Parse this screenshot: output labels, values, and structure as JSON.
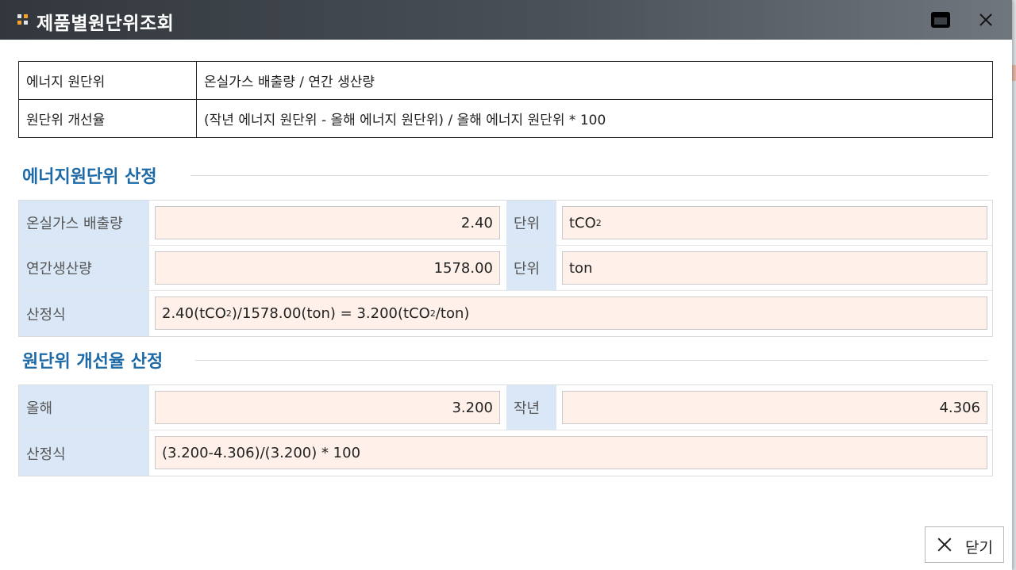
{
  "window": {
    "title": "제품별원단위조회"
  },
  "info_table": [
    {
      "key": "에너지 원단위",
      "value": "온실가스 배출량 / 연간 생산량"
    },
    {
      "key": "원단위 개선율",
      "value": "(작년 에너지 원단위 - 올해 에너지 원단위) / 올해 에너지 원단위 * 100"
    }
  ],
  "section1": {
    "title": "에너지원단위 산정",
    "emission_label": "온실가스 배출량",
    "emission_value": "2.40",
    "emission_unit_label": "단위",
    "emission_unit_base": "tCO",
    "emission_unit_sub": "2",
    "production_label": "연간생산량",
    "production_value": "1578.00",
    "production_unit_label": "단위",
    "production_unit": "ton",
    "formula_label": "산정식",
    "formula": {
      "p1": "2.40(tCO",
      "s1": "2",
      "p2": ")/1578.00(ton) = 3.200(tCO",
      "s2": "2",
      "p3": "/ton)"
    }
  },
  "section2": {
    "title": "원단위 개선율 산정",
    "this_year_label": "올해",
    "this_year_value": "3.200",
    "last_year_label": "작년",
    "last_year_value": "4.306",
    "formula_label": "산정식",
    "formula": "(3.200-4.306)/(3.200) * 100"
  },
  "footer": {
    "close_label": "닫기"
  }
}
